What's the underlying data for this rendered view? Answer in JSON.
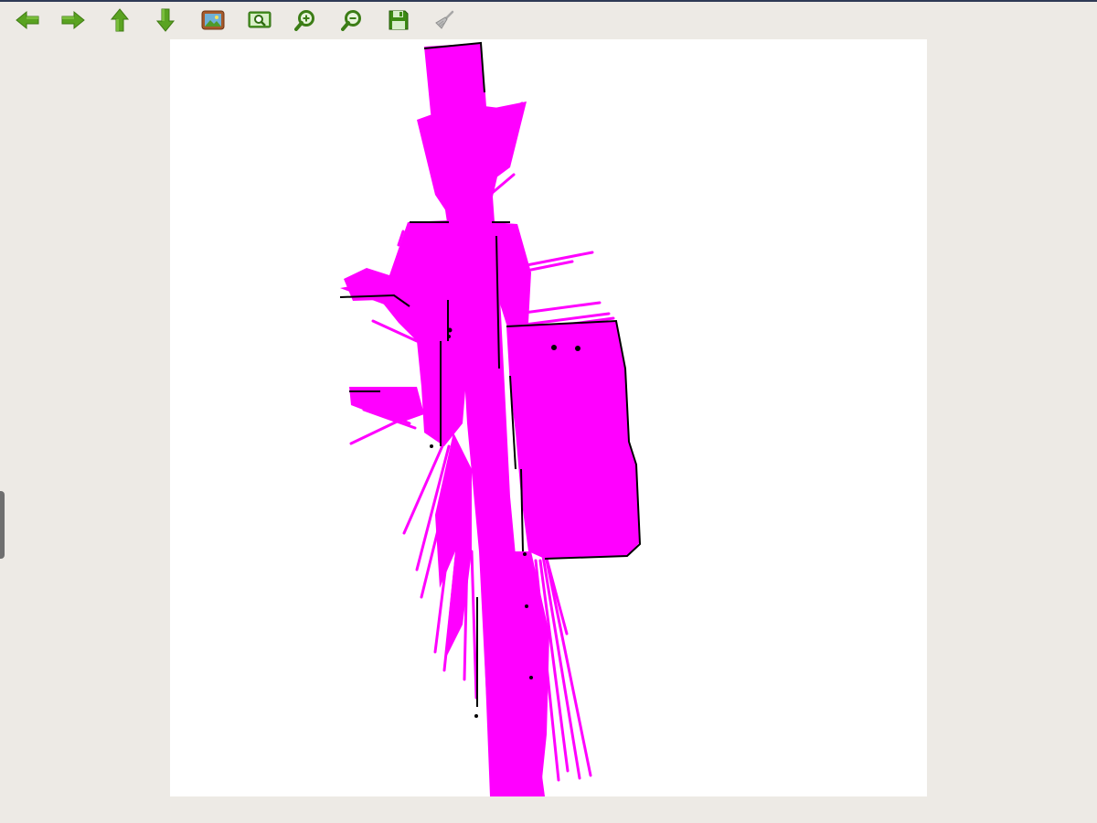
{
  "toolbar": {
    "buttons": [
      {
        "name": "back-button",
        "icon": "arrow-left-icon",
        "color": "#5aa321",
        "enabled": true
      },
      {
        "name": "forward-button",
        "icon": "arrow-right-icon",
        "color": "#5aa321",
        "enabled": true
      },
      {
        "name": "up-button",
        "icon": "arrow-up-icon",
        "color": "#5aa321",
        "enabled": true
      },
      {
        "name": "down-button",
        "icon": "arrow-down-icon",
        "color": "#5aa321",
        "enabled": true
      },
      {
        "name": "fit-view-button",
        "icon": "picture-icon",
        "color": "#a6592a",
        "enabled": true
      },
      {
        "name": "zoom-region-button",
        "icon": "zoom-region-icon",
        "color": "#4f9a2a",
        "enabled": true
      },
      {
        "name": "zoom-in-button",
        "icon": "zoom-in-icon",
        "color": "#4f9a2a",
        "enabled": true
      },
      {
        "name": "zoom-out-button",
        "icon": "zoom-out-icon",
        "color": "#4f9a2a",
        "enabled": true
      },
      {
        "name": "save-button",
        "icon": "floppy-disk-icon",
        "color": "#4f9a2a",
        "enabled": true
      },
      {
        "name": "clear-button",
        "icon": "broom-icon",
        "color": "#9a9a9a",
        "enabled": false
      }
    ]
  },
  "map": {
    "free_color": "#ff00ff",
    "obstacle_color": "#000000",
    "background_color": "#ffffff"
  },
  "colors": {
    "window_background": "#edeae5",
    "accent_green": "#5aa321"
  }
}
